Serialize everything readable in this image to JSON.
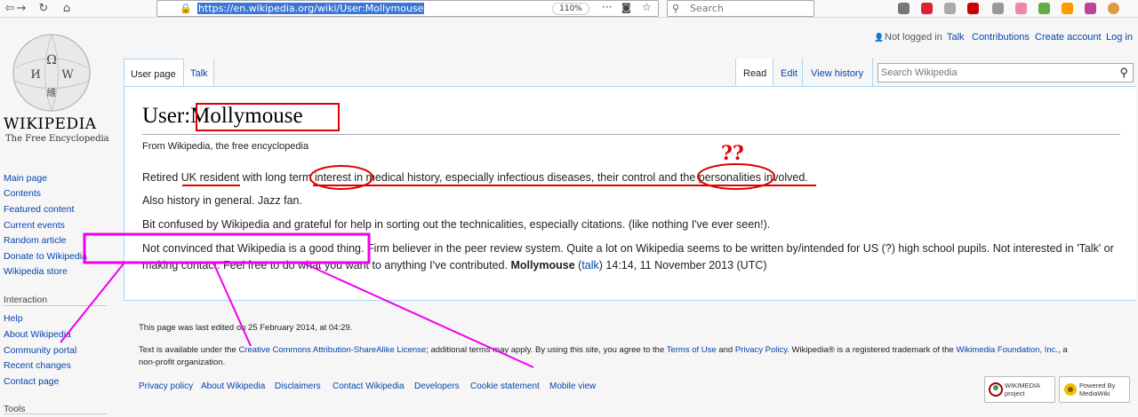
{
  "browser": {
    "url": "https://en.wikipedia.org/wiki/User:Mollymouse",
    "zoom": "110%",
    "search_placeholder": "Search"
  },
  "logo": {
    "title": "WIKIPEDIA",
    "subtitle": "The Free Encyclopedia"
  },
  "sidebar": {
    "items": [
      "Main page",
      "Contents",
      "Featured content",
      "Current events",
      "Random article",
      "Donate to Wikipedia",
      "Wikipedia store"
    ],
    "interaction_heading": "Interaction",
    "interaction_items": [
      "Help",
      "About Wikipedia",
      "Community portal",
      "Recent changes",
      "Contact page"
    ],
    "tools_heading": "Tools"
  },
  "personal": {
    "not_logged_in": "Not logged in",
    "talk": "Talk",
    "contributions": "Contributions",
    "create_account": "Create account",
    "log_in": "Log in"
  },
  "tabs": {
    "user_page": "User page",
    "talk": "Talk",
    "read": "Read",
    "edit": "Edit",
    "view_history": "View history"
  },
  "search": {
    "placeholder": "Search Wikipedia"
  },
  "article": {
    "title_prefix": "User:",
    "title_name": "Mollymouse",
    "from": "From Wikipedia, the free encyclopedia",
    "p1": {
      "a": "Retired ",
      "b": "UK resident",
      "c": " with long term interest in medical history, especially infectious diseases, their control and the personalities involved."
    },
    "p2": "Also history in general. Jazz fan.",
    "p3": "Bit confused by Wikipedia and grateful for help in sorting out the technicalities, especially citations. (like nothing I've ever seen!).",
    "p4": "Not convinced that Wikipedia is a good thing. Firm believer in the peer review system. Quite a lot on Wikipedia seems to be written by/intended for US (?) high school pupils. Not interested in 'Talk' or",
    "p5": {
      "a": "making contact. Feel free to do what you want to anything I've contributed. ",
      "user": "Mollymouse",
      "b": " (",
      "talk": "talk",
      "c": ") 14:14, 11 November 2013 (UTC)"
    },
    "annotation": "??"
  },
  "footer": {
    "last_edited": "This page was last edited on 25 February 2014, at 04:29.",
    "license_a": "Text is available under the ",
    "license_link": "Creative Commons Attribution-ShareAlike License",
    "license_b": "; additional terms may apply. By using this site, you agree to the ",
    "terms": "Terms of Use",
    "and": " and ",
    "privacy": "Privacy Policy",
    "license_c": ". Wikipedia® is a registered trademark of the ",
    "foundation": "Wikimedia Foundation, Inc.",
    "license_d": ", a",
    "license_e": "non-profit organization.",
    "links": [
      "Privacy policy",
      "About Wikipedia",
      "Disclaimers",
      "Contact Wikipedia",
      "Developers",
      "Cookie statement",
      "Mobile view"
    ],
    "wikimedia_badge": "WIKIMEDIA project",
    "mediawiki_badge": "Powered By MediaWiki"
  },
  "colors": {
    "highlight_red": "#dd0000",
    "highlight_magenta": "#ee00ee",
    "link": "#0645ad"
  }
}
